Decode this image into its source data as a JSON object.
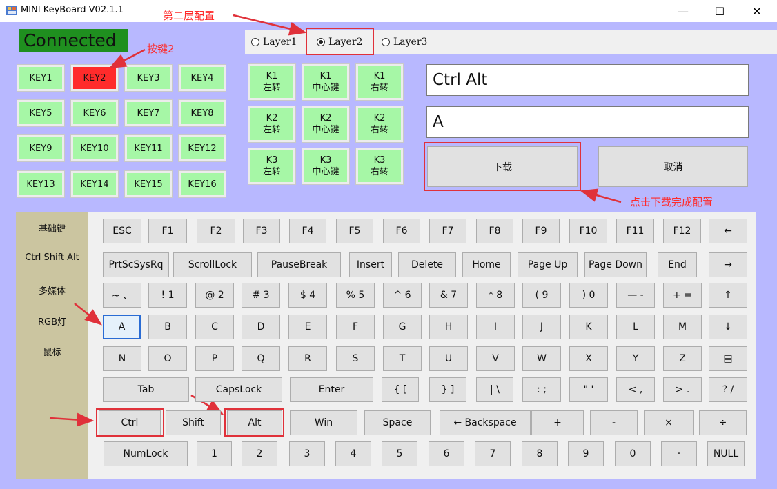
{
  "window": {
    "title": "MINI KeyBoard V02.1.1",
    "controls": {
      "minimize": "—",
      "maximize": "☐",
      "close": "✕"
    }
  },
  "annotations": {
    "layer2_config": "第二层配置",
    "key2": "按键2",
    "download_hint": "点击下载完成配置"
  },
  "status": {
    "connected": "Connected"
  },
  "layers": [
    {
      "label": "Layer1",
      "selected": false
    },
    {
      "label": "Layer2",
      "selected": true
    },
    {
      "label": "Layer3",
      "selected": false
    }
  ],
  "keys": [
    "KEY1",
    "KEY2",
    "KEY3",
    "KEY4",
    "KEY5",
    "KEY6",
    "KEY7",
    "KEY8",
    "KEY9",
    "KEY10",
    "KEY11",
    "KEY12",
    "KEY13",
    "KEY14",
    "KEY15",
    "KEY16"
  ],
  "selected_key": "KEY2",
  "encoders": [
    {
      "top": "K1",
      "bottom": "左转"
    },
    {
      "top": "K1",
      "bottom": "中心键"
    },
    {
      "top": "K1",
      "bottom": "右转"
    },
    {
      "top": "K2",
      "bottom": "左转"
    },
    {
      "top": "K2",
      "bottom": "中心键"
    },
    {
      "top": "K2",
      "bottom": "右转"
    },
    {
      "top": "K3",
      "bottom": "左转"
    },
    {
      "top": "K3",
      "bottom": "中心键"
    },
    {
      "top": "K3",
      "bottom": "右转"
    }
  ],
  "modifier_field": "Ctrl Alt",
  "key_field": "A",
  "buttons": {
    "download": "下载",
    "cancel": "取消"
  },
  "categories": [
    "基础键",
    "Ctrl Shift Alt",
    "多媒体",
    "RGB灯",
    "鼠标"
  ],
  "keyboard_rows": [
    [
      "ESC",
      "F1",
      "F2",
      "F3",
      "F4",
      "F5",
      "F6",
      "F7",
      "F8",
      "F9",
      "F10",
      "F11",
      "F12",
      "←"
    ],
    [
      "PrtScSysRq",
      "ScrollLock",
      "PauseBreak",
      "Insert",
      "Delete",
      "Home",
      "Page Up",
      "Page Down",
      "End",
      "→"
    ],
    [
      "~ 、",
      "! 1",
      "@ 2",
      "# 3",
      "$ 4",
      "% 5",
      "^ 6",
      "& 7",
      "* 8",
      "( 9",
      ") 0",
      "— -",
      "+ =",
      "↑"
    ],
    [
      "A",
      "B",
      "C",
      "D",
      "E",
      "F",
      "G",
      "H",
      "I",
      "J",
      "K",
      "L",
      "M",
      "↓"
    ],
    [
      "N",
      "O",
      "P",
      "Q",
      "R",
      "S",
      "T",
      "U",
      "V",
      "W",
      "X",
      "Y",
      "Z",
      "▤"
    ],
    [
      "Tab",
      "CapsLock",
      "Enter",
      "{ [",
      "} ]",
      "| \\",
      ": ;",
      "\" '",
      "< ,",
      "> .",
      "? /"
    ],
    [
      "Ctrl",
      "Shift",
      "Alt",
      "Win",
      "Space",
      "← Backspace",
      "+",
      "-",
      "×",
      "÷"
    ],
    [
      "NumLock",
      "1",
      "2",
      "3",
      "4",
      "5",
      "6",
      "7",
      "8",
      "9",
      "0",
      "·",
      "NULL"
    ]
  ]
}
